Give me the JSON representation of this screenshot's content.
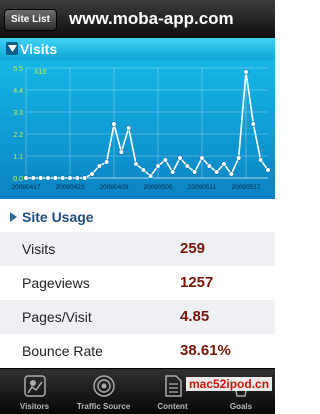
{
  "nav": {
    "site_list": "Site List",
    "title": "www.moba-app.com"
  },
  "visits": {
    "title": "Visits"
  },
  "chart_data": {
    "type": "line",
    "multiplier_label": "X10",
    "y_ticks": [
      "0.0",
      "1.1",
      "2.2",
      "3.3",
      "4.4",
      "5.5"
    ],
    "ylim": [
      0,
      5.5
    ],
    "x_tick_labels": [
      "20090417",
      "20090423",
      "20090429",
      "20090505",
      "20090511",
      "20090517"
    ],
    "x": [
      "20090417",
      "20090418",
      "20090419",
      "20090420",
      "20090421",
      "20090422",
      "20090423",
      "20090424",
      "20090425",
      "20090426",
      "20090427",
      "20090428",
      "20090429",
      "20090430",
      "20090501",
      "20090502",
      "20090503",
      "20090504",
      "20090505",
      "20090506",
      "20090507",
      "20090508",
      "20090509",
      "20090510",
      "20090511",
      "20090512",
      "20090513",
      "20090514",
      "20090515",
      "20090516",
      "20090517",
      "20090518",
      "20090519",
      "20090520"
    ],
    "series": [
      {
        "values": [
          0,
          0,
          0,
          0,
          0,
          0,
          0,
          0,
          0,
          0.2,
          0.6,
          0.8,
          2.7,
          1.3,
          2.5,
          0.7,
          0.4,
          0.1,
          0.6,
          0.9,
          0.3,
          1.0,
          0.6,
          0.3,
          1.0,
          0.6,
          0.3,
          0.7,
          0.2,
          1.0,
          5.3,
          2.7,
          0.9,
          0.4
        ]
      }
    ],
    "colors": {
      "line": "#ffffff",
      "accent": "#c8f047"
    }
  },
  "site_usage": {
    "title": "Site Usage",
    "rows": [
      {
        "label": "Visits",
        "value": "259"
      },
      {
        "label": "Pageviews",
        "value": "1257"
      },
      {
        "label": "Pages/Visit",
        "value": "4.85"
      },
      {
        "label": "Bounce Rate",
        "value": "38.61%"
      }
    ]
  },
  "tabs": [
    {
      "label": "Visitors",
      "icon": "visitors-icon"
    },
    {
      "label": "Traffic Source",
      "icon": "traffic-source-icon"
    },
    {
      "label": "Content",
      "icon": "content-icon"
    },
    {
      "label": "Goals",
      "icon": "goals-icon"
    }
  ],
  "watermark": "mac52ipod.cn"
}
